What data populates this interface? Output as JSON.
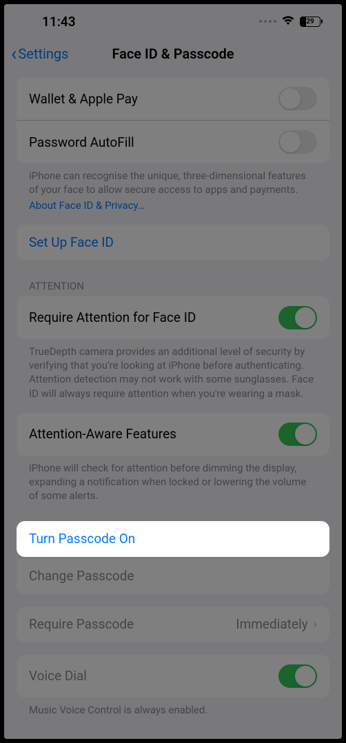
{
  "status": {
    "time": "11:43",
    "battery": "29"
  },
  "nav": {
    "back": "Settings",
    "title": "Face ID & Passcode"
  },
  "useFaceId": {
    "wallet": "Wallet & Apple Pay",
    "autofill": "Password AutoFill",
    "footer": "iPhone can recognise the unique, three-dimensional features of your face to allow secure access to apps and payments.",
    "footerLink": "About Face ID & Privacy…"
  },
  "setup": {
    "label": "Set Up Face ID"
  },
  "attention": {
    "header": "Attention",
    "require": "Require Attention for Face ID",
    "requireFooter": "TrueDepth camera provides an additional level of security by verifying that you're looking at iPhone before authenticating. Attention detection may not work with some sunglasses. Face ID will always require attention when you're wearing a mask.",
    "aware": "Attention-Aware Features",
    "awareFooter": "iPhone will check for attention before dimming the display, expanding a notification when locked or lowering the volume of some alerts."
  },
  "passcode": {
    "turnOn": "Turn Passcode On",
    "change": "Change Passcode",
    "require": "Require Passcode",
    "requireValue": "Immediately"
  },
  "voice": {
    "dial": "Voice Dial",
    "footer": "Music Voice Control is always enabled."
  }
}
